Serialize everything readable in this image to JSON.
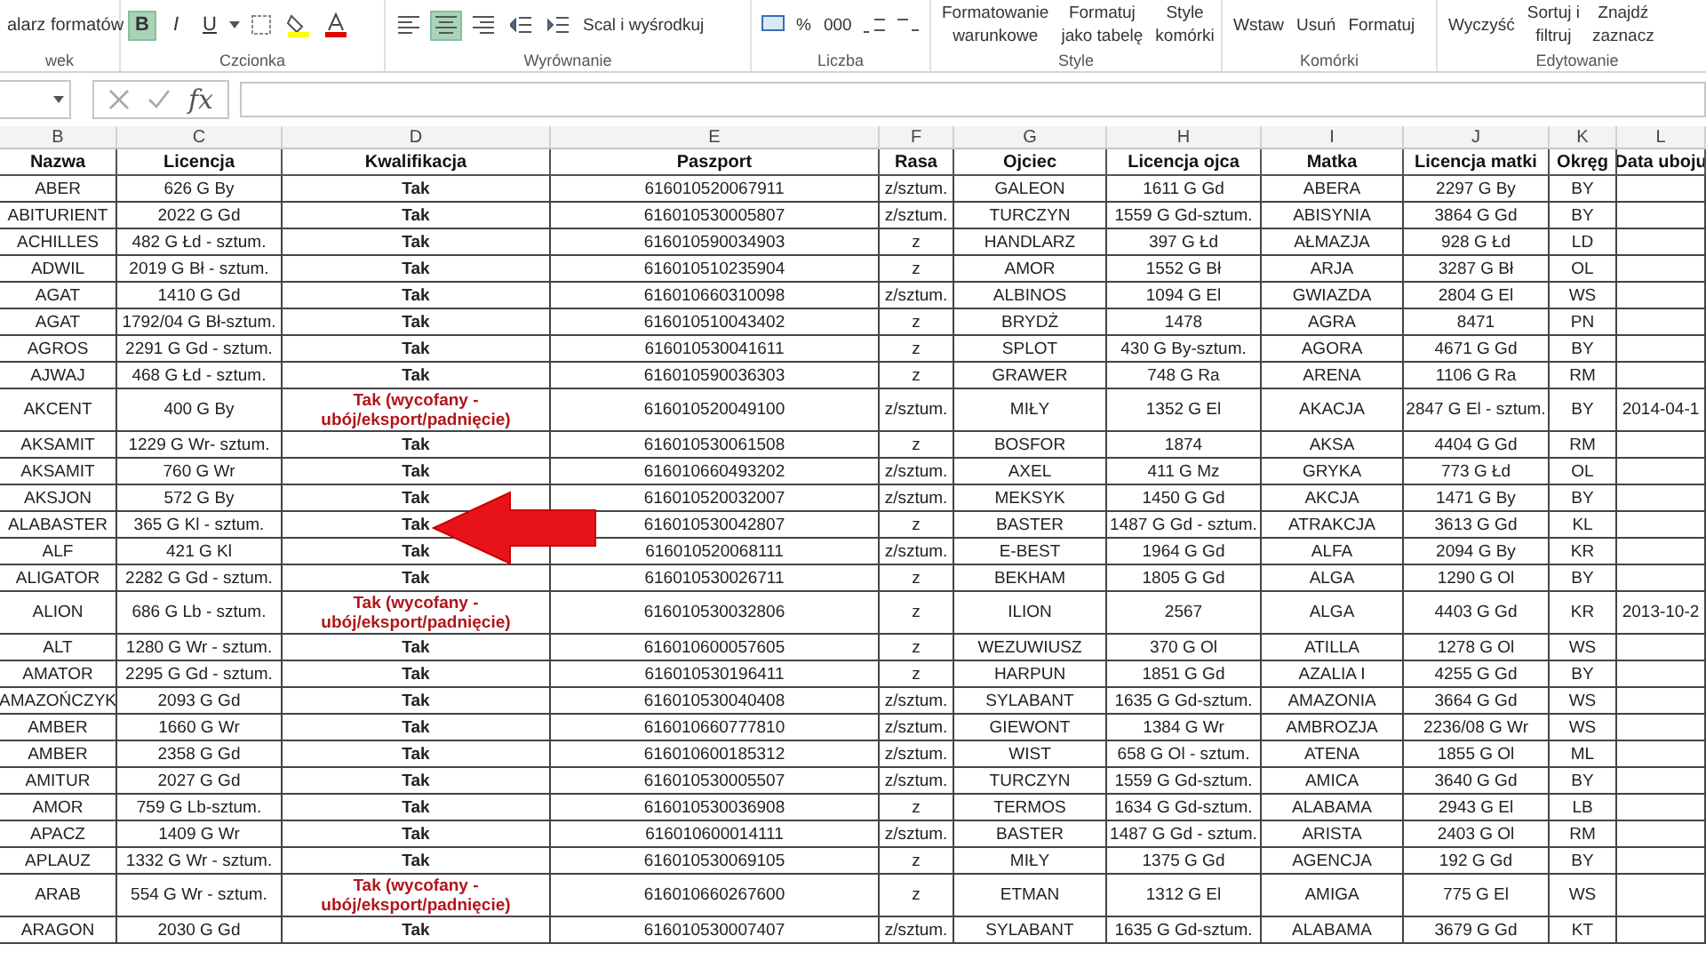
{
  "ribbon": {
    "clipboard_fragment": "alarz formatów",
    "groups": [
      {
        "label": "wek"
      },
      {
        "label": "Czcionka"
      },
      {
        "label": "Wyrównanie"
      },
      {
        "label": "Liczba"
      },
      {
        "label": "Style"
      },
      {
        "label": "Komórki"
      },
      {
        "label": "Edytowanie"
      }
    ],
    "font_buttons": [
      {
        "text": "B",
        "selected": true
      },
      {
        "text": "I",
        "selected": false
      },
      {
        "text": "U",
        "selected": false
      }
    ],
    "align_buttons": [
      {
        "selected": false
      },
      {
        "selected": true
      },
      {
        "selected": false
      }
    ],
    "merge_label": "Scal i wyśrodkuj",
    "number_symbols": [
      "%",
      "000"
    ],
    "style_buttons": [
      {
        "line1": "Formatowanie",
        "line2": "warunkowe"
      },
      {
        "line1": "Formatuj",
        "line2": "jako tabelę"
      },
      {
        "line1": "Style",
        "line2": "komórki"
      }
    ],
    "cell_buttons": [
      "Wstaw",
      "Usuń",
      "Formatuj"
    ],
    "clear_label": "Wyczyść",
    "edit_buttons": [
      {
        "line1": "Sortuj i",
        "line2": "filtruj"
      },
      {
        "line1": "Znajdź",
        "line2": "zaznacz"
      }
    ]
  },
  "formula_bar": {
    "function_label": "fx"
  },
  "sheet": {
    "column_letters": [
      "B",
      "C",
      "D",
      "E",
      "F",
      "G",
      "H",
      "I",
      "J",
      "K",
      "L"
    ],
    "headers": [
      "Nazwa",
      "Licencja",
      "Kwalifikacja",
      "Paszport",
      "Rasa",
      "Ojciec",
      "Licencja ojca",
      "Matka",
      "Licencja matki",
      "Okręg",
      "Data uboju"
    ],
    "rows": [
      {
        "withdrawn": false,
        "cells": [
          "ABER",
          "626 G By",
          "Tak",
          "616010520067911",
          "z/sztum.",
          "GALEON",
          "1611 G Gd",
          "ABERA",
          "2297 G By",
          "BY",
          ""
        ]
      },
      {
        "withdrawn": false,
        "cells": [
          "ABITURIENT",
          "2022 G Gd",
          "Tak",
          "616010530005807",
          "z/sztum.",
          "TURCZYN",
          "1559 G Gd-sztum.",
          "ABISYNIA",
          "3864 G Gd",
          "BY",
          ""
        ]
      },
      {
        "withdrawn": false,
        "cells": [
          "ACHILLES",
          "482 G Łd - sztum.",
          "Tak",
          "616010590034903",
          "z",
          "HANDLARZ",
          "397 G Łd",
          "AŁMAZJA",
          "928 G Łd",
          "LD",
          ""
        ]
      },
      {
        "withdrawn": false,
        "cells": [
          "ADWIL",
          "2019 G Bł - sztum.",
          "Tak",
          "616010510235904",
          "z",
          "AMOR",
          "1552 G Bł",
          "ARJA",
          "3287 G Bł",
          "OL",
          ""
        ]
      },
      {
        "withdrawn": false,
        "cells": [
          "AGAT",
          "1410 G Gd",
          "Tak",
          "616010660310098",
          "z/sztum.",
          "ALBINOS",
          "1094 G El",
          "GWIAZDA",
          "2804 G El",
          "WS",
          ""
        ]
      },
      {
        "withdrawn": false,
        "cells": [
          "AGAT",
          "1792/04 G Bł-sztum.",
          "Tak",
          "616010510043402",
          "z",
          "BRYDŻ",
          "1478",
          "AGRA",
          "8471",
          "PN",
          ""
        ]
      },
      {
        "withdrawn": false,
        "cells": [
          "AGROS",
          "2291 G Gd - sztum.",
          "Tak",
          "616010530041611",
          "z",
          "SPLOT",
          "430 G By-sztum.",
          "AGORA",
          "4671 G Gd",
          "BY",
          ""
        ]
      },
      {
        "withdrawn": false,
        "cells": [
          "AJWAJ",
          "468 G Łd - sztum.",
          "Tak",
          "616010590036303",
          "z",
          "GRAWER",
          "748 G Ra",
          "ARENA",
          "1106 G Ra",
          "RM",
          ""
        ]
      },
      {
        "withdrawn": true,
        "cells": [
          "AKCENT",
          "400 G By",
          "Tak (wycofany - ubój/eksport/padnięcie)",
          "616010520049100",
          "z/sztum.",
          "MIŁY",
          "1352 G El",
          "AKACJA",
          "2847 G El - sztum.",
          "BY",
          "2014-04-1"
        ]
      },
      {
        "withdrawn": false,
        "cells": [
          "AKSAMIT",
          "1229 G Wr- sztum.",
          "Tak",
          "616010530061508",
          "z",
          "BOSFOR",
          "1874",
          "AKSA",
          "4404 G Gd",
          "RM",
          ""
        ]
      },
      {
        "withdrawn": false,
        "cells": [
          "AKSAMIT",
          "760 G Wr",
          "Tak",
          "616010660493202",
          "z/sztum.",
          "AXEL",
          "411 G Mz",
          "GRYKA",
          "773 G Łd",
          "OL",
          ""
        ]
      },
      {
        "withdrawn": false,
        "cells": [
          "AKSJON",
          "572 G By",
          "Tak",
          "616010520032007",
          "z/sztum.",
          "MEKSYK",
          "1450 G Gd",
          "AKCJA",
          "1471 G By",
          "BY",
          ""
        ]
      },
      {
        "withdrawn": false,
        "cells": [
          "ALABASTER",
          "365 G Kl - sztum.",
          "Tak",
          "616010530042807",
          "z",
          "BASTER",
          "1487 G Gd - sztum.",
          "ATRAKCJA",
          "3613 G Gd",
          "KL",
          ""
        ]
      },
      {
        "withdrawn": false,
        "cells": [
          "ALF",
          "421 G Kl",
          "Tak",
          "616010520068111",
          "z/sztum.",
          "E-BEST",
          "1964 G Gd",
          "ALFA",
          "2094 G By",
          "KR",
          ""
        ]
      },
      {
        "withdrawn": false,
        "cells": [
          "ALIGATOR",
          "2282 G Gd - sztum.",
          "Tak",
          "616010530026711",
          "z",
          "BEKHAM",
          "1805 G Gd",
          "ALGA",
          "1290 G Ol",
          "BY",
          ""
        ]
      },
      {
        "withdrawn": true,
        "cells": [
          "ALION",
          "686 G Lb - sztum.",
          "Tak (wycofany - ubój/eksport/padnięcie)",
          "616010530032806",
          "z",
          "ILION",
          "2567",
          "ALGA",
          "4403 G Gd",
          "KR",
          "2013-10-2"
        ]
      },
      {
        "withdrawn": false,
        "cells": [
          "ALT",
          "1280 G Wr - sztum.",
          "Tak",
          "616010600057605",
          "z",
          "WEZUWIUSZ",
          "370 G Ol",
          "ATILLA",
          "1278 G Ol",
          "WS",
          ""
        ]
      },
      {
        "withdrawn": false,
        "cells": [
          "AMATOR",
          "2295 G Gd - sztum.",
          "Tak",
          "616010530196411",
          "z",
          "HARPUN",
          "1851 G Gd",
          "AZALIA I",
          "4255 G Gd",
          "BY",
          ""
        ]
      },
      {
        "withdrawn": false,
        "cells": [
          "AMAZOŃCZYK",
          "2093 G Gd",
          "Tak",
          "616010530040408",
          "z/sztum.",
          "SYLABANT",
          "1635 G Gd-sztum.",
          "AMAZONIA",
          "3664 G Gd",
          "WS",
          ""
        ]
      },
      {
        "withdrawn": false,
        "cells": [
          "AMBER",
          "1660 G Wr",
          "Tak",
          "616010660777810",
          "z/sztum.",
          "GIEWONT",
          "1384 G Wr",
          "AMBROZJA",
          "2236/08 G Wr",
          "WS",
          ""
        ]
      },
      {
        "withdrawn": false,
        "cells": [
          "AMBER",
          "2358 G Gd",
          "Tak",
          "616010600185312",
          "z/sztum.",
          "WIST",
          "658 G Ol - sztum.",
          "ATENA",
          "1855 G Ol",
          "ML",
          ""
        ]
      },
      {
        "withdrawn": false,
        "cells": [
          "AMITUR",
          "2027 G Gd",
          "Tak",
          "616010530005507",
          "z/sztum.",
          "TURCZYN",
          "1559 G Gd-sztum.",
          "AMICA",
          "3640 G Gd",
          "BY",
          ""
        ]
      },
      {
        "withdrawn": false,
        "cells": [
          "AMOR",
          "759 G Lb-sztum.",
          "Tak",
          "616010530036908",
          "z",
          "TERMOS",
          "1634 G Gd-sztum.",
          "ALABAMA",
          "2943 G El",
          "LB",
          ""
        ]
      },
      {
        "withdrawn": false,
        "cells": [
          "APACZ",
          "1409 G Wr",
          "Tak",
          "616010600014111",
          "z/sztum.",
          "BASTER",
          "1487 G Gd - sztum.",
          "ARISTA",
          "2403 G Ol",
          "RM",
          ""
        ]
      },
      {
        "withdrawn": false,
        "cells": [
          "APLAUZ",
          "1332 G Wr - sztum.",
          "Tak",
          "616010530069105",
          "z",
          "MIŁY",
          "1375 G Gd",
          "AGENCJA",
          "192 G Gd",
          "BY",
          ""
        ]
      },
      {
        "withdrawn": true,
        "cells": [
          "ARAB",
          "554 G Wr - sztum.",
          "Tak (wycofany - ubój/eksport/padnięcie)",
          "616010660267600",
          "z",
          "ETMAN",
          "1312 G El",
          "AMIGA",
          "775 G El",
          "WS",
          ""
        ]
      },
      {
        "withdrawn": false,
        "cells": [
          "ARAGON",
          "2030 G Gd",
          "Tak",
          "616010530007407",
          "z/sztum.",
          "SYLABANT",
          "1635 G Gd-sztum.",
          "ALABAMA",
          "3679 G Gd",
          "KT",
          ""
        ]
      }
    ]
  }
}
